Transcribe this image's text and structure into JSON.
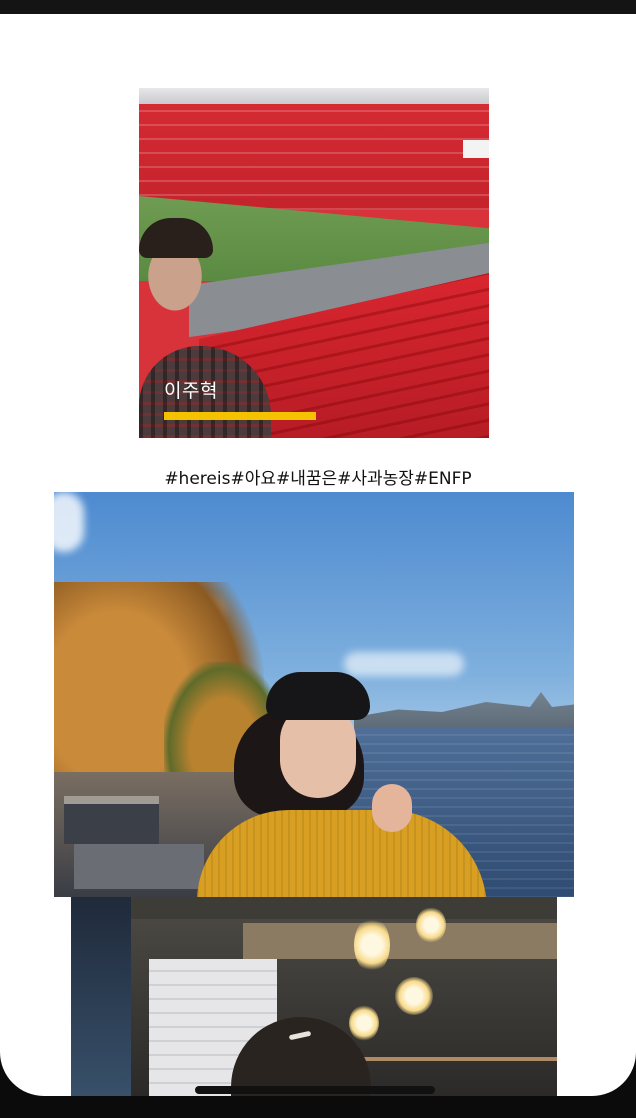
{
  "profile": {
    "name": "이주혁",
    "hashtags": "#hereis#아요#내꿈은#사과농장#ENFP"
  },
  "photos": [
    {
      "description_icon": "stadium-photo"
    },
    {
      "description_icon": "river-portrait-photo"
    },
    {
      "description_icon": "cafe-lights-photo"
    }
  ],
  "colors": {
    "accent_bar": "#f4c200",
    "background": "#ffffff",
    "frame": "#0b0b0b"
  }
}
